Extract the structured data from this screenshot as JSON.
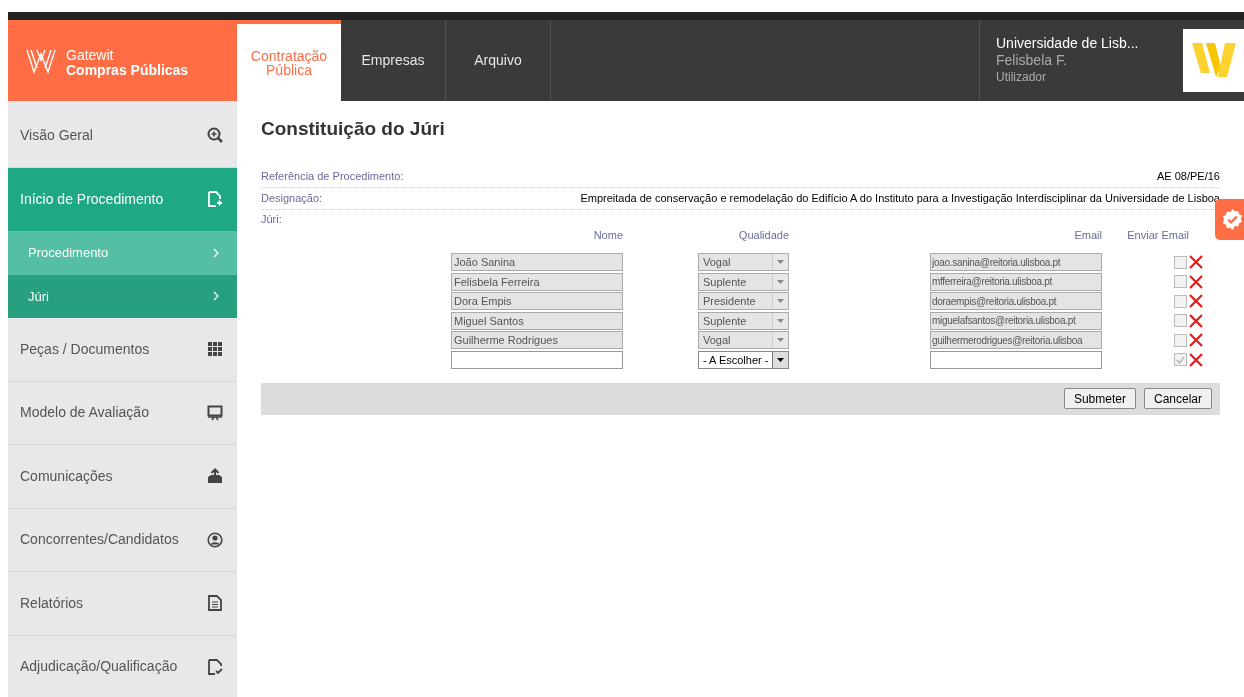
{
  "brand": {
    "name": "Gatewit",
    "product": "Compras Públicas"
  },
  "tabs": [
    {
      "label": "Contratação Pública",
      "selected": true
    },
    {
      "label": "Empresas",
      "selected": false
    },
    {
      "label": "Arquivo",
      "selected": false
    }
  ],
  "user": {
    "organization": "Universidade de Lisb...",
    "name": "Felisbela F.",
    "role": "Utilizador"
  },
  "sidebar": {
    "items": [
      {
        "label": "Visão Geral",
        "kind": "main",
        "selected": false
      },
      {
        "label": "Início de Procedimento",
        "kind": "main",
        "selected": true
      },
      {
        "label": "Procedimento",
        "kind": "sub",
        "selected": false
      },
      {
        "label": "Júri",
        "kind": "sub",
        "selected": true
      },
      {
        "label": "Peças / Documentos",
        "kind": "main",
        "selected": false
      },
      {
        "label": "Modelo de Avaliação",
        "kind": "main",
        "selected": false
      },
      {
        "label": "Comunicações",
        "kind": "main",
        "selected": false
      },
      {
        "label": "Concorrentes/Candidatos",
        "kind": "main",
        "selected": false
      },
      {
        "label": "Relatórios",
        "kind": "main",
        "selected": false
      },
      {
        "label": "Adjudicação/Qualificação",
        "kind": "main",
        "selected": false
      }
    ]
  },
  "page_title": "Constituição do Júri",
  "info": [
    {
      "label": "Referência de Procedimento:",
      "value": "AE 08/PE/16"
    },
    {
      "label": "Designação:",
      "value": "Empreitada de conservação e remodelação do Edifício A do Instituto para a Investigação Interdisciplinar da Universidade de Lisboa"
    }
  ],
  "jury": {
    "label": "Júri:",
    "columns": [
      "Nome",
      "Qualidade",
      "Email",
      "Enviar Email"
    ],
    "rows": [
      {
        "name": "João Sanina",
        "quality": "Vogal",
        "email": "joao.sanina@reitoria.ulisboa.pt",
        "send_email": false,
        "disabled": true
      },
      {
        "name": "Felisbela Ferreira",
        "quality": "Suplente",
        "email": "mfferreira@reitoria.ulisboa.pt",
        "send_email": false,
        "disabled": true
      },
      {
        "name": "Dora Empis",
        "quality": "Presidente",
        "email": "doraempis@reitoria.ulisboa.pt",
        "send_email": false,
        "disabled": true
      },
      {
        "name": "Miguel Santos",
        "quality": "Suplente",
        "email": "miguelafsantos@reitoria.ulisboa.pt",
        "send_email": false,
        "disabled": true
      },
      {
        "name": "Guilherme Rodrigues",
        "quality": "Vogal",
        "email": "guilhermerodrigues@reitoria.ulisboa",
        "send_email": false,
        "disabled": true
      },
      {
        "name": "",
        "quality": "- A Escolher -",
        "email": "",
        "send_email": true,
        "disabled": false
      }
    ]
  },
  "buttons": [
    "Submeter",
    "Cancelar"
  ]
}
